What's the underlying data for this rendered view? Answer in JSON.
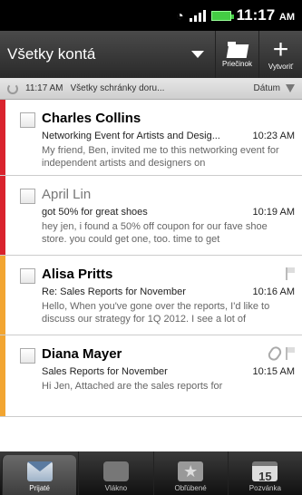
{
  "status_bar": {
    "time": "11:17",
    "ampm": "AM"
  },
  "action_bar": {
    "account": "Všetky kontá",
    "folder_label": "Priečinok",
    "compose_label": "Vytvoriť"
  },
  "sync_bar": {
    "time": "11:17 AM",
    "filter": "Všetky schránky doru...",
    "sort": "Dátum"
  },
  "messages": [
    {
      "sender": "Charles Collins",
      "subject": "Networking Event for Artists and Desig...",
      "time": "10:23 AM",
      "preview": "My friend, Ben, invited me to this networking event for independent artists and designers on",
      "unread": true,
      "color": "#d9232d"
    },
    {
      "sender": "April Lin",
      "subject": "got 50% for great shoes",
      "time": "10:19 AM",
      "preview": "hey jen,  i found a 50% off coupon for our fave shoe store. you could get one, too. time to get",
      "unread": false,
      "color": "#d9232d"
    },
    {
      "sender": "Alisa Pritts",
      "subject": "Re: Sales Reports for November",
      "time": "10:16 AM",
      "preview": "Hello, When you've gone over the reports, I'd like to discuss our strategy for 1Q 2012. I see a lot of",
      "unread": true,
      "color": "#f2a531"
    },
    {
      "sender": "Diana Mayer",
      "subject": "Sales Reports for November",
      "time": "10:15 AM",
      "preview": "Hi Jen, Attached are the sales reports for",
      "unread": true,
      "color": "#f2a531"
    }
  ],
  "tabs": [
    {
      "label": "Prijaté",
      "icon": "inbox-icon",
      "active": true
    },
    {
      "label": "Vlákno",
      "icon": "conversation-icon",
      "active": false
    },
    {
      "label": "Obľúbené",
      "icon": "favorites-icon",
      "active": false
    },
    {
      "label": "Pozvánka",
      "icon": "calendar-icon",
      "active": false,
      "badge": "15"
    }
  ]
}
